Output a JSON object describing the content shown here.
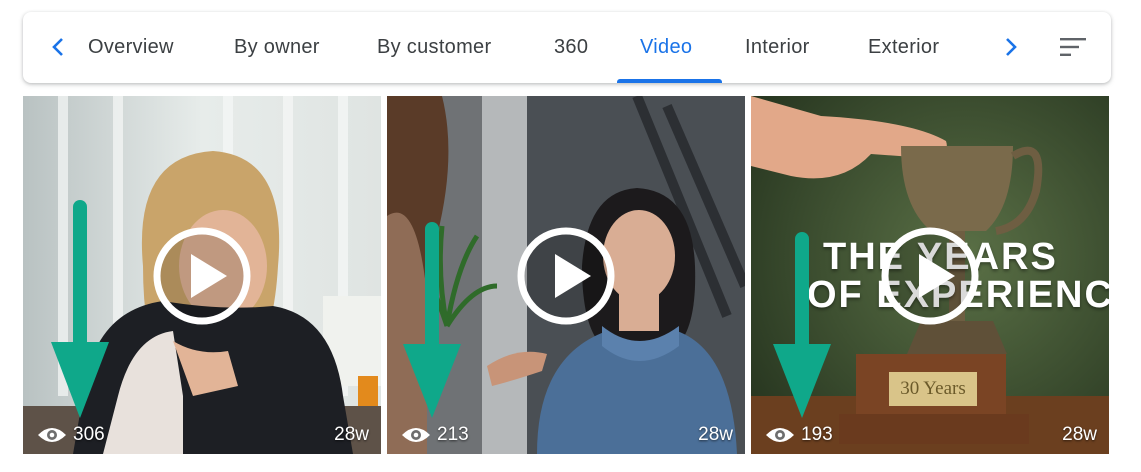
{
  "tabs": {
    "items": [
      {
        "label": "Overview"
      },
      {
        "label": "By owner"
      },
      {
        "label": "By customer"
      },
      {
        "label": "360"
      },
      {
        "label": "Video",
        "active": true
      },
      {
        "label": "Interior"
      },
      {
        "label": "Exterior"
      }
    ],
    "icons": {
      "prev": "chevron-left-icon",
      "next": "chevron-right-icon",
      "sort": "sort-icon"
    }
  },
  "videos": [
    {
      "views": "306",
      "age": "28w"
    },
    {
      "views": "213",
      "age": "28w"
    },
    {
      "views": "193",
      "age": "28w",
      "overlay_line1": "THE YEARS",
      "overlay_line2": "OF EXPERIENCE",
      "plaque": "30 Years"
    }
  ],
  "colors": {
    "accent": "#1a73e8",
    "tab_text": "#3c4043",
    "annotation_arrow": "#0fa88a"
  },
  "icons": {
    "views": "eye-icon",
    "play": "play-icon",
    "annotation": "down-arrow-annotation"
  }
}
